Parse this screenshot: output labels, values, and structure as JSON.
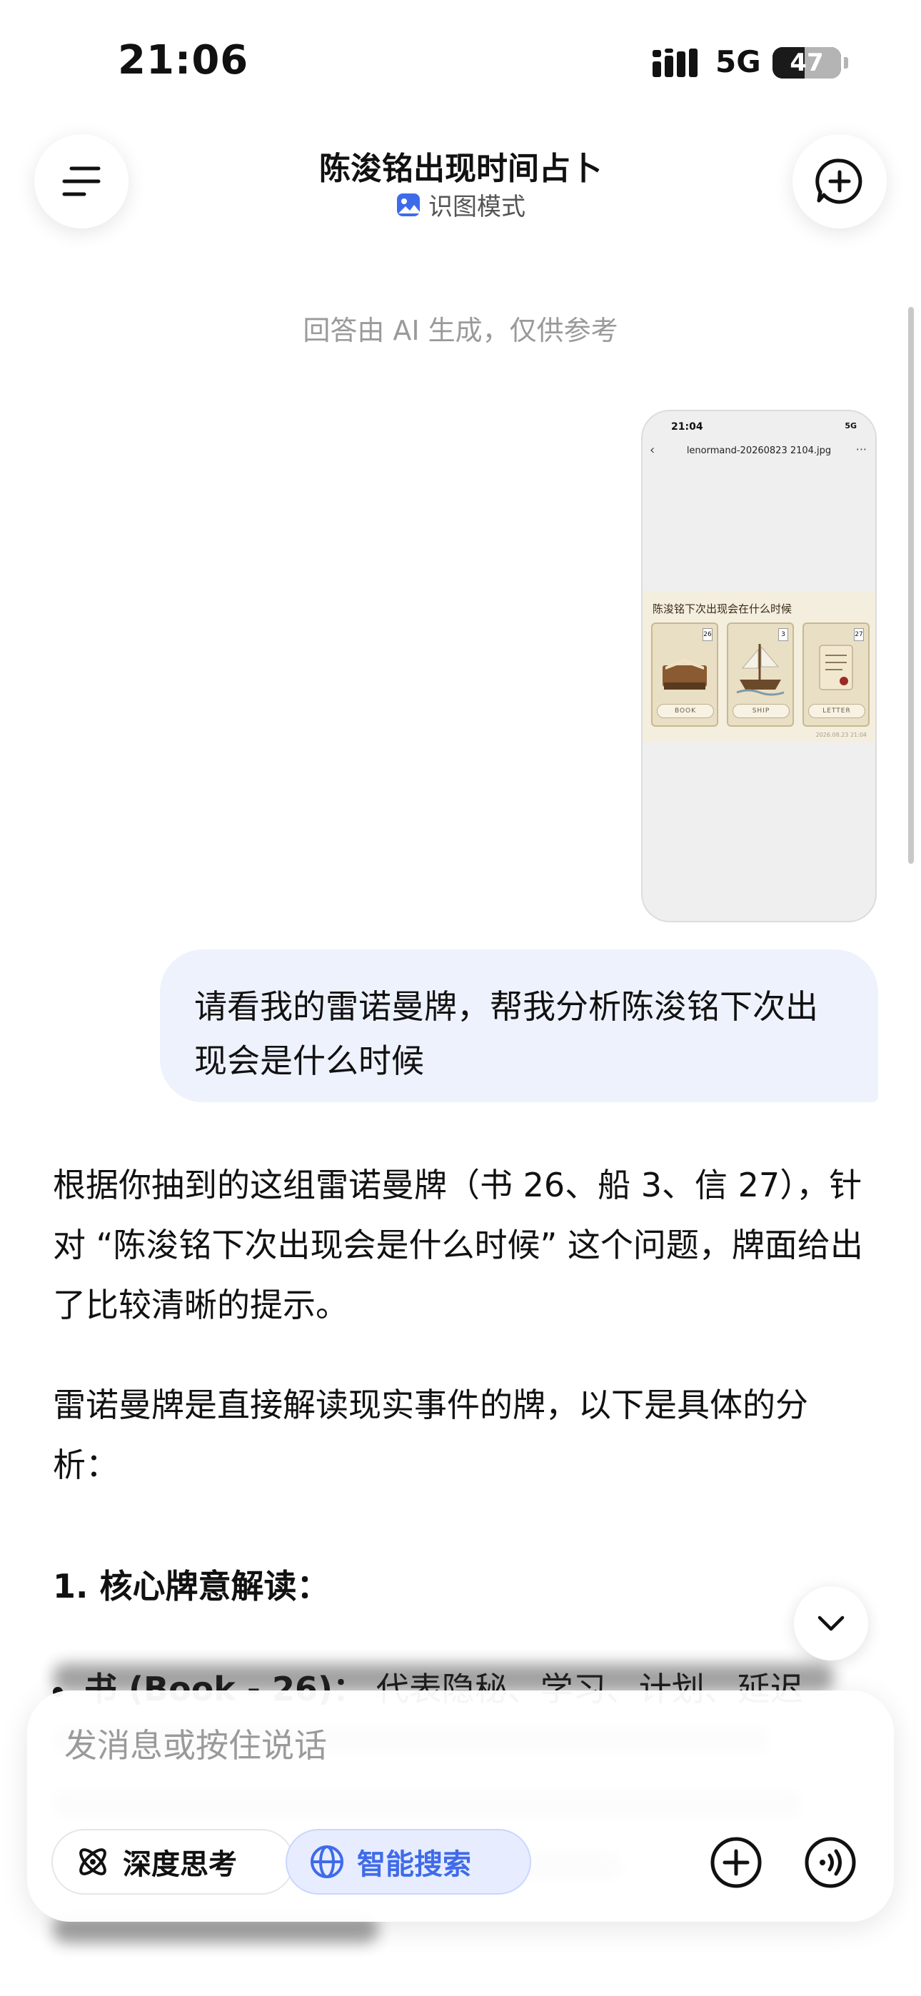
{
  "status_bar": {
    "time": "21:06",
    "network": "5G",
    "battery": "47",
    "battery_level": 0.47
  },
  "header": {
    "title": "陈浚铭出现时间占卜",
    "mode_label": "识图模式"
  },
  "disclaimer": "回答由 AI 生成，仅供参考",
  "attached_image": {
    "time": "21:04",
    "status": "5G",
    "filename": "lenormand-20260823 2104.jpg",
    "question": "陈浚铭下次出现会在什么时候",
    "cards": [
      {
        "number": "26",
        "name": "BOOK"
      },
      {
        "number": "3",
        "name": "SHIP"
      },
      {
        "number": "27",
        "name": "LETTER"
      }
    ],
    "watermark": "2026.08.23 21:04"
  },
  "user_message": "请看我的雷诺曼牌，帮我分析陈浚铭下次出现会是什么时候",
  "reply": {
    "p1": "根据你抽到的这组雷诺曼牌（书 26、船 3、信 27），针对 “陈浚铭下次出现会是什么时候” 这个问题，牌面给出了比较清晰的提示。",
    "p2": "雷诺曼牌是直接解读现实事件的牌，以下是具体的分析：",
    "heading1": "1. 核心牌意解读：",
    "bullet1_term": "书 (Book - 26)：",
    "bullet1_text": "代表隐秘、学习、计划、延迟"
  },
  "composer": {
    "placeholder": "发消息或按住说话",
    "chip_think": "深度思考",
    "chip_search": "智能搜索"
  },
  "colors": {
    "accent": "#3f6bea",
    "bubble": "#eef2fd"
  }
}
